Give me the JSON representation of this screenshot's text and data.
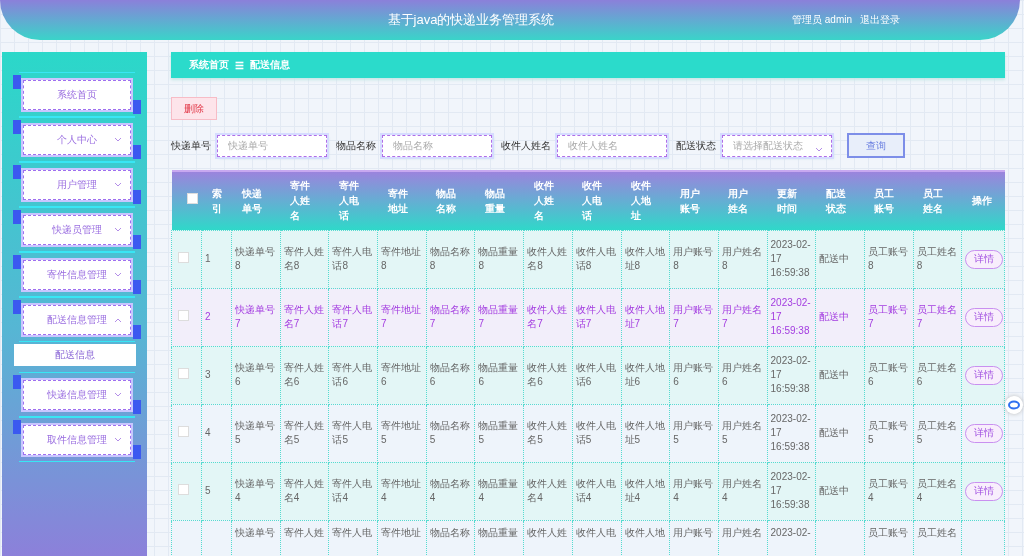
{
  "header": {
    "title": "基于java的快递业务管理系统",
    "user": "管理员 admin",
    "logout": "退出登录"
  },
  "sidebar": {
    "items": [
      {
        "label": "系统首页"
      },
      {
        "label": "个人中心",
        "expanded": false
      },
      {
        "label": "用户管理",
        "expanded": false
      },
      {
        "label": "快递员管理",
        "expanded": false
      },
      {
        "label": "寄件信息管理",
        "expanded": false
      },
      {
        "label": "配送信息管理",
        "expanded": true,
        "children": [
          {
            "label": "配送信息",
            "selected": true
          }
        ]
      },
      {
        "label": "快递信息管理",
        "expanded": false
      },
      {
        "label": "取件信息管理",
        "expanded": false
      }
    ]
  },
  "breadcrumb": {
    "home": "系统首页",
    "separator": "☰",
    "current": "配送信息"
  },
  "delete_button": "删除",
  "search": {
    "fields": [
      {
        "label": "快递单号",
        "placeholder": "快递单号",
        "kind": "input"
      },
      {
        "label": "物品名称",
        "placeholder": "物品名称",
        "kind": "input"
      },
      {
        "label": "收件人姓名",
        "placeholder": "收件人姓名",
        "kind": "input"
      },
      {
        "label": "配送状态",
        "placeholder": "请选择配送状态",
        "kind": "select"
      }
    ],
    "button": "查询"
  },
  "table": {
    "select_all_checked": false,
    "columns": [
      "索引",
      "快递单号",
      "寄件人姓名",
      "寄件人电话",
      "寄件地址",
      "物品名称",
      "物品重量",
      "收件人姓名",
      "收件人电话",
      "收件人地址",
      "用户账号",
      "用户姓名",
      "更新时间",
      "配送状态",
      "员工账号",
      "员工姓名",
      "操作"
    ],
    "rows": [
      {
        "checked": false,
        "highlighted": false,
        "cells": [
          "1",
          "快递单号8",
          "寄件人姓名8",
          "寄件人电话8",
          "寄件地址8",
          "物品名称8",
          "物品重量8",
          "收件人姓名8",
          "收件人电话8",
          "收件人地址8",
          "用户账号8",
          "用户姓名8",
          "2023-02-17 16:59:38",
          "配送中",
          "员工账号8",
          "员工姓名8"
        ],
        "action": "详情"
      },
      {
        "checked": false,
        "highlighted": true,
        "cells": [
          "2",
          "快递单号7",
          "寄件人姓名7",
          "寄件人电话7",
          "寄件地址7",
          "物品名称7",
          "物品重量7",
          "收件人姓名7",
          "收件人电话7",
          "收件人地址7",
          "用户账号7",
          "用户姓名7",
          "2023-02-17 16:59:38",
          "配送中",
          "员工账号7",
          "员工姓名7"
        ],
        "action": "详情"
      },
      {
        "checked": false,
        "highlighted": false,
        "cells": [
          "3",
          "快递单号6",
          "寄件人姓名6",
          "寄件人电话6",
          "寄件地址6",
          "物品名称6",
          "物品重量6",
          "收件人姓名6",
          "收件人电话6",
          "收件人地址6",
          "用户账号6",
          "用户姓名6",
          "2023-02-17 16:59:38",
          "配送中",
          "员工账号6",
          "员工姓名6"
        ],
        "action": "详情"
      },
      {
        "checked": false,
        "highlighted": false,
        "cells": [
          "4",
          "快递单号5",
          "寄件人姓名5",
          "寄件人电话5",
          "寄件地址5",
          "物品名称5",
          "物品重量5",
          "收件人姓名5",
          "收件人电话5",
          "收件人地址5",
          "用户账号5",
          "用户姓名5",
          "2023-02-17 16:59:38",
          "配送中",
          "员工账号5",
          "员工姓名5"
        ],
        "action": "详情"
      },
      {
        "checked": false,
        "highlighted": false,
        "cells": [
          "5",
          "快递单号4",
          "寄件人姓名4",
          "寄件人电话4",
          "寄件地址4",
          "物品名称4",
          "物品重量4",
          "收件人姓名4",
          "收件人电话4",
          "收件人地址4",
          "用户账号4",
          "用户姓名4",
          "2023-02-17 16:59:38",
          "配送中",
          "员工账号4",
          "员工姓名4"
        ],
        "action": "详情"
      },
      {
        "highlighted": false,
        "cells": [
          "",
          "快递单号",
          "寄件人姓",
          "寄件人电",
          "寄件地址",
          "物品名称",
          "物品重量",
          "收件人姓",
          "收件人电",
          "收件人地",
          "用户账号",
          "用户姓名",
          "2023-02-",
          "",
          "员工账号",
          "员工姓名"
        ]
      }
    ]
  }
}
